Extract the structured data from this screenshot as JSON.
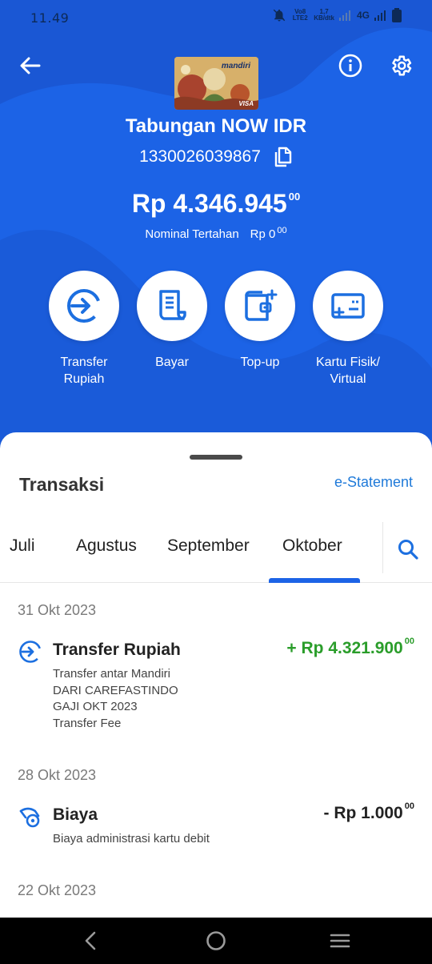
{
  "status_bar": {
    "time": "11.49",
    "volte_label": "Vo8 LTE2",
    "speed_value": "1,7",
    "speed_unit": "KB/dtk",
    "network": "4G"
  },
  "header": {
    "card_bank_label": "mandiri",
    "card_network": "VISA",
    "account_title": "Tabungan NOW IDR",
    "account_number": "1330026039867",
    "balance_main": "Rp 4.346.945",
    "balance_cents": "00",
    "held_label": "Nominal Tertahan",
    "held_amount": "Rp 0",
    "held_cents": "00"
  },
  "actions": [
    {
      "label_line1": "Transfer",
      "label_line2": "Rupiah",
      "icon": "transfer-icon"
    },
    {
      "label_line1": "Bayar",
      "label_line2": "",
      "icon": "bill-icon"
    },
    {
      "label_line1": "Top-up",
      "label_line2": "",
      "icon": "wallet-icon"
    },
    {
      "label_line1": "Kartu Fisik/",
      "label_line2": "Virtual",
      "icon": "card-icon"
    }
  ],
  "transactions_panel": {
    "title": "Transaksi",
    "estatement_label": "e-Statement",
    "tabs": [
      "Juli",
      "Agustus",
      "September",
      "Oktober"
    ],
    "active_tab": "Oktober",
    "groups": [
      {
        "date": "31 Okt 2023",
        "items": [
          {
            "title": "Transfer Rupiah",
            "amount": "+ Rp 4.321.900",
            "cents": "00",
            "amount_color": "#2a9d2a",
            "details": [
              "Transfer antar Mandiri",
              "DARI CAREFASTINDO",
              "GAJI OKT 2023",
              "Transfer Fee"
            ]
          }
        ]
      },
      {
        "date": "28 Okt 2023",
        "items": [
          {
            "title": "Biaya",
            "amount": "- Rp 1.000",
            "cents": "00",
            "amount_color": "#222222",
            "details": [
              "Biaya administrasi kartu debit"
            ]
          }
        ]
      },
      {
        "date": "22 Okt 2023",
        "items": []
      }
    ]
  },
  "colors": {
    "primary_blue": "#1c63e6",
    "link_blue": "#1f7ad9",
    "credit_green": "#2a9d2a"
  }
}
